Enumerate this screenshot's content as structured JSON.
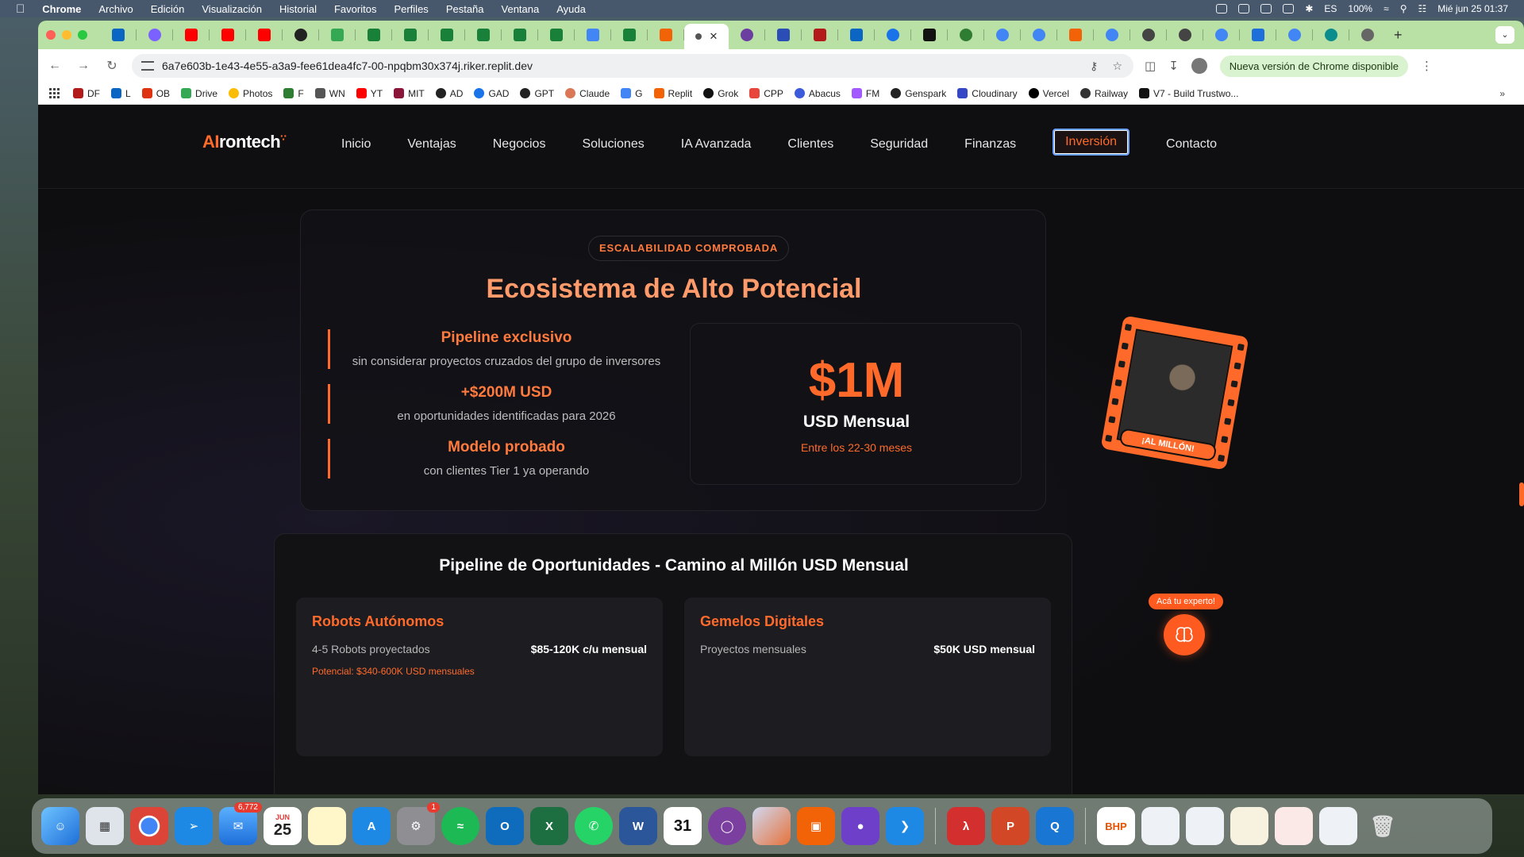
{
  "menubar": {
    "items": [
      "Chrome",
      "Archivo",
      "Edición",
      "Visualización",
      "Historial",
      "Favoritos",
      "Perfiles",
      "Pestaña",
      "Ventana",
      "Ayuda"
    ],
    "keyboard": "ES",
    "battery": "100%",
    "clock": "Mié jun 25  01:37"
  },
  "browser": {
    "url": "6a7e603b-1e43-4e55-a3a9-fee61dea4fc7-00-npqbm30x374j.riker.replit.dev",
    "update_label": "Nueva versión de Chrome disponible",
    "bookmarks": [
      "DF",
      "L",
      "OB",
      "Drive",
      "Photos",
      "F",
      "WN",
      "YT",
      "MIT",
      "AD",
      "GAD",
      "GPT",
      "Claude",
      "G",
      "Replit",
      "Grok",
      "CPP",
      "Abacus",
      "FM",
      "Genspark",
      "Cloudinary",
      "Vercel",
      "Railway",
      "V7 - Build Trustwo..."
    ]
  },
  "site": {
    "logo_ai": "AI",
    "logo_rest": "rontech",
    "nav": [
      "Inicio",
      "Ventajas",
      "Negocios",
      "Soluciones",
      "IA Avanzada",
      "Clientes",
      "Seguridad",
      "Finanzas",
      "Inversión",
      "Contacto"
    ],
    "active_nav": "Inversión"
  },
  "hero": {
    "badge": "ESCALABILIDAD COMPROBADA",
    "title": "Ecosistema de Alto Potencial",
    "stats": [
      {
        "title": "Pipeline exclusivo",
        "subtitle": "sin considerar proyectos cruzados del grupo de inversores"
      },
      {
        "title": "+$200M USD",
        "subtitle": "en oportunidades identificadas para 2026"
      },
      {
        "title": "Modelo probado",
        "subtitle": "con clientes Tier 1 ya operando"
      }
    ],
    "money": {
      "value": "$1M",
      "unit": "USD Mensual",
      "sub": "Entre los 22-30 meses"
    }
  },
  "pipeline": {
    "title": "Pipeline de Oportunidades - Camino al Millón USD Mensual",
    "cards": [
      {
        "title": "Robots Autónomos",
        "label": "4-5 Robots proyectados",
        "value": "$85-120K c/u mensual",
        "potential": "Potencial: $340-600K USD mensuales"
      },
      {
        "title": "Gemelos Digitales",
        "label": "Proyectos mensuales",
        "value": "$50K USD mensual",
        "potential": ""
      }
    ]
  },
  "film_label": "¡AL MILLÓN!",
  "expert_tip": "Acá tu experto!",
  "dock": {
    "mail_badge": "6,772",
    "calendar_month": "JUN",
    "calendar_day": "25",
    "settings_badge": "1",
    "calendar_app_day": "31",
    "bhp_label": "BHP"
  },
  "colors": {
    "accent": "#ff6a2b",
    "tab_strip": "#b9e0a5"
  }
}
